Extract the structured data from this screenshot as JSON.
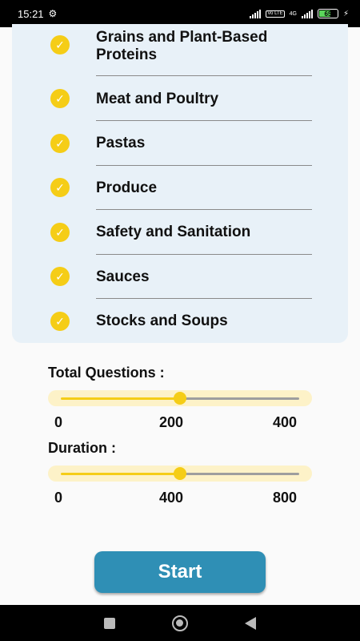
{
  "status_bar": {
    "time": "15:21",
    "volte_tag": "Vo LTE",
    "network_type": "4G",
    "battery_level": "65",
    "battery_fraction": 0.65
  },
  "categories": [
    {
      "label": "Grains and Plant-Based Proteins",
      "checked": true
    },
    {
      "label": "Meat and Poultry",
      "checked": true
    },
    {
      "label": "Pastas",
      "checked": true
    },
    {
      "label": "Produce",
      "checked": true
    },
    {
      "label": "Safety and Sanitation",
      "checked": true
    },
    {
      "label": "Sauces",
      "checked": true
    },
    {
      "label": "Stocks and Soups",
      "checked": true
    }
  ],
  "total_questions": {
    "label": "Total Questions :",
    "min": "0",
    "mid": "200",
    "max": "400",
    "value": 200,
    "range": [
      0,
      400
    ]
  },
  "duration": {
    "label": "Duration :",
    "min": "0",
    "mid": "400",
    "max": "800",
    "value": 400,
    "range": [
      0,
      800
    ]
  },
  "start_button": {
    "label": "Start"
  },
  "colors": {
    "accent": "#f5cd17",
    "card_bg": "#e8f1f8",
    "button": "#2f8fb5",
    "track_bg": "#fdf2c8",
    "track_inactive": "#9e9e9e"
  },
  "icons": {
    "check": "check-circle-icon",
    "settings": "gear-icon",
    "nav_recents": "square-icon",
    "nav_home": "circle-icon",
    "nav_back": "triangle-back-icon"
  }
}
